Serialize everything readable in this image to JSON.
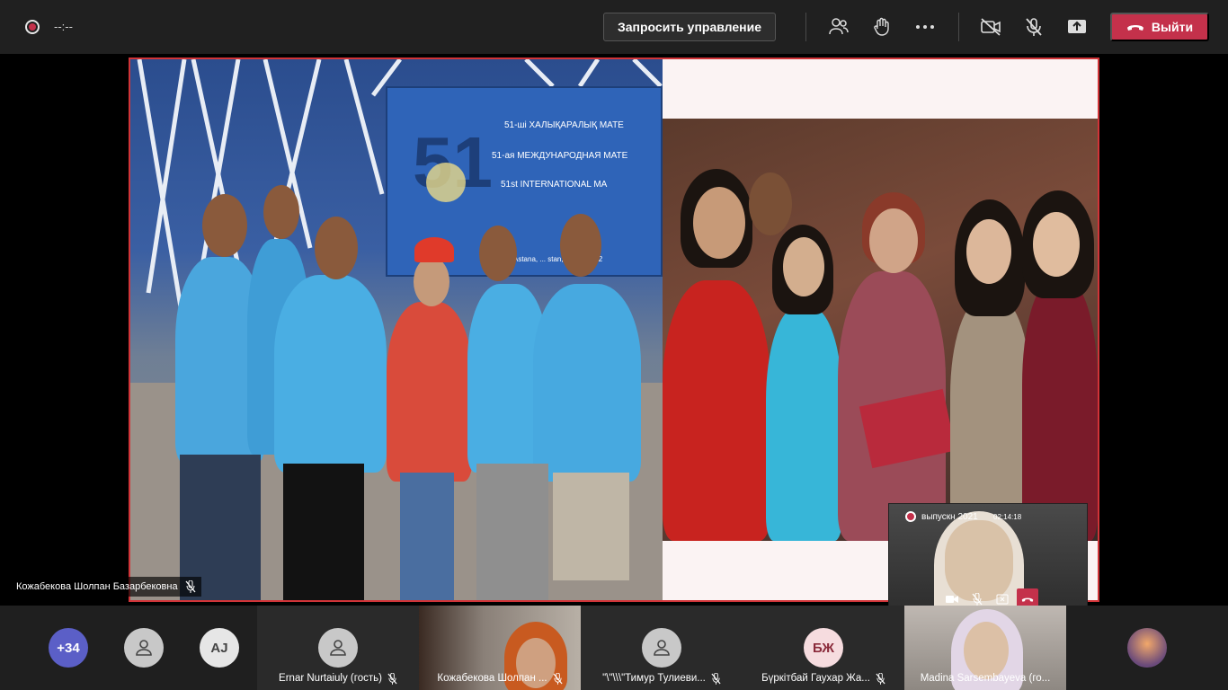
{
  "topbar": {
    "timer": "--:--",
    "request_control_label": "Запросить управление",
    "leave_label": "Выйти"
  },
  "colors": {
    "accent_red": "#c4314b",
    "share_border": "#d13438",
    "bar_bg": "#202020"
  },
  "share": {
    "banner_lines": [
      "51-ші ХАЛЫҚАРАЛЫҚ МАТЕ",
      "51-ая МЕЖДУНАРОДНАЯ МАТЕ",
      "51st INTERNATIONAL MA",
      "Astana, ... stan, July 2-14, 2"
    ]
  },
  "pip": {
    "title": "выпускн 2021",
    "time": "02:14:18"
  },
  "presenter": {
    "name": "Кожабекова Шолпан Базарбековна"
  },
  "gallery": {
    "overflow_count": "+34",
    "avatar_initials_aj": "AJ",
    "tiles": [
      {
        "name": "Ernar Nurtaiuly (гость)"
      },
      {
        "name": "Кожабекова Шолпан ..."
      },
      {
        "name": "\"\\\"\\\\\\\"Тимур Тулиеви..."
      },
      {
        "name": "Бүркітбай Гаухар Жа...",
        "initials": "БЖ"
      },
      {
        "name": "Madina Sarsembayeva (го..."
      }
    ]
  }
}
